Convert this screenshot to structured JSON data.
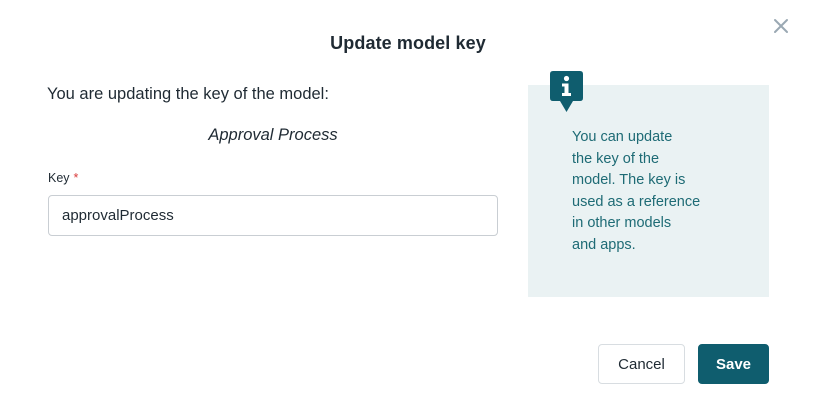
{
  "dialog": {
    "title": "Update model key",
    "close_icon": "close-icon"
  },
  "body": {
    "intro": "You are updating the key of the model:",
    "model_name": "Approval Process",
    "key_field": {
      "label": "Key",
      "required_marker": "*",
      "value": "approvalProcess"
    }
  },
  "info": {
    "icon": "info-icon",
    "lines": [
      "You can update",
      "the key of the",
      "model. The key is",
      "used as a reference",
      "in other models",
      "and apps."
    ]
  },
  "footer": {
    "cancel_label": "Cancel",
    "save_label": "Save"
  },
  "colors": {
    "accent": "#0f5d6e",
    "info_background": "#eaf2f3",
    "info_text": "#1e6b75",
    "required": "#d93b3b"
  }
}
